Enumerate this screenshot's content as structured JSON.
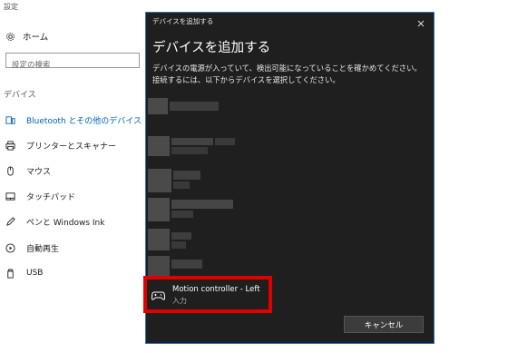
{
  "settings": {
    "app_title": "設定",
    "home_label": "ホーム",
    "search_placeholder": "設定の検索",
    "section_title": "デバイス",
    "nav": [
      {
        "label": "Bluetooth とその他のデバイス",
        "icon": "bluetooth-devices-icon",
        "selected": true
      },
      {
        "label": "プリンターとスキャナー",
        "icon": "printer-icon"
      },
      {
        "label": "マウス",
        "icon": "mouse-icon"
      },
      {
        "label": "タッチパッド",
        "icon": "touchpad-icon"
      },
      {
        "label": "ペンと Windows Ink",
        "icon": "pen-icon"
      },
      {
        "label": "自動再生",
        "icon": "autoplay-icon"
      },
      {
        "label": "USB",
        "icon": "usb-icon"
      }
    ]
  },
  "dialog": {
    "titlebar": "デバイスを追加する",
    "heading": "デバイスを追加する",
    "description": "デバイスの電源が入っていて、検出可能になっていることを確かめてください。接続するには、以下からデバイスを選択してください。",
    "device": {
      "name": "Motion controller - Left",
      "type": "入力",
      "icon": "gamepad-icon"
    },
    "cancel_label": "キャンセル"
  },
  "colors": {
    "accent": "#0063b1",
    "dialog_bg": "#1f1f1f",
    "highlight": "#e00000"
  }
}
